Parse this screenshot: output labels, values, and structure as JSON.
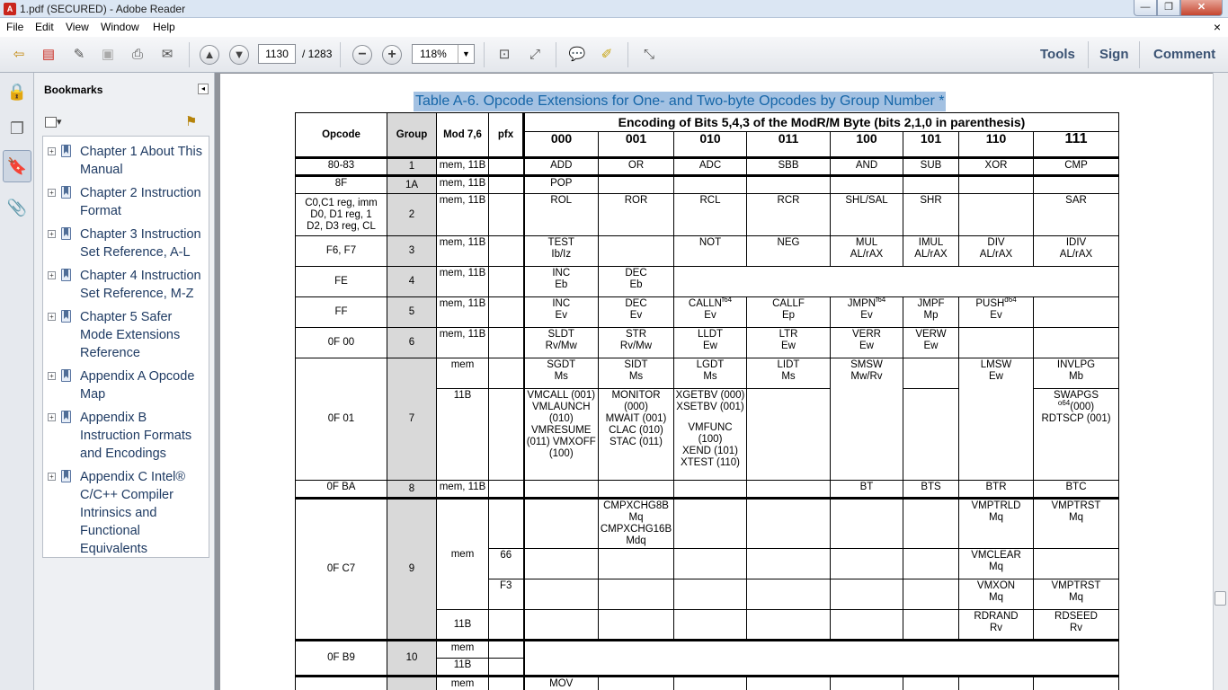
{
  "window": {
    "title": "1.pdf (SECURED) - Adobe Reader",
    "app_icon": "pdf-icon",
    "min_glyph": "—",
    "max_glyph": "❐",
    "close_glyph": "✕"
  },
  "menu": {
    "items": [
      "File",
      "Edit",
      "View",
      "Window",
      "Help"
    ],
    "close_glyph": "×"
  },
  "toolbar": {
    "page_current": "1130",
    "page_total": "/ 1283",
    "zoom": "118%",
    "zoom_arrow": "▼",
    "right_links": {
      "tools": "Tools",
      "sign": "Sign",
      "comment": "Comment"
    }
  },
  "bookmarks": {
    "title": "Bookmarks",
    "collapse_glyph": "◂",
    "options_glyph": "▾",
    "find_glyph": "⚑",
    "expand_glyph": "+",
    "items": [
      "Chapter 1 About This Manual",
      "Chapter 2 Instruction Format",
      "Chapter 3 Instruction Set Reference, A-L",
      "Chapter 4 Instruction Set Reference, M-Z",
      "Chapter 5 Safer Mode Extensions Reference",
      "Appendix A Opcode Map",
      "Appendix B Instruction Formats and Encodings",
      "Appendix C Intel® C/C++ Compiler Intrinsics and Functional Equivalents"
    ]
  },
  "doc": {
    "table_title": "Table A-6.  Opcode Extensions for One- and Two-byte Opcodes by Group Number *",
    "header": {
      "opcode": "Opcode",
      "group": "Group",
      "mod": "Mod 7,6",
      "pfx": "pfx",
      "encoding": "Encoding of Bits 5,4,3 of the ModR/M Byte (bits 2,1,0 in parenthesis)",
      "bits": [
        "000",
        "001",
        "010",
        "011",
        "100",
        "101",
        "110",
        "111"
      ]
    },
    "rows": {
      "r1": {
        "op": "80-83",
        "grp": "1",
        "mod": "mem, 11B",
        "c": [
          "ADD",
          "OR",
          "ADC",
          "SBB",
          "AND",
          "SUB",
          "XOR",
          "CMP"
        ]
      },
      "r1a": {
        "op": "8F",
        "grp": "1A",
        "mod": "mem, 11B",
        "c0": "POP"
      },
      "r2": {
        "op1": "C0,C1 reg, imm",
        "op2": "D0, D1 reg, 1",
        "op3": "D2, D3 reg, CL",
        "grp": "2",
        "mod": "mem, 11B",
        "c": [
          "ROL",
          "ROR",
          "RCL",
          "RCR",
          "SHL/SAL",
          "SHR",
          "",
          "SAR"
        ]
      },
      "r3": {
        "op": "F6, F7",
        "grp": "3",
        "mod": "mem, 11B",
        "test": "TEST",
        "test2": "Ib/Iz",
        "not": "NOT",
        "neg": "NEG",
        "mul": "MUL",
        "mul2": "AL/rAX",
        "imul": "IMUL",
        "imul2": "AL/rAX",
        "div": "DIV",
        "div2": "AL/rAX",
        "idiv": "IDIV",
        "idiv2": "AL/rAX"
      },
      "r4": {
        "op": "FE",
        "grp": "4",
        "mod": "mem, 11B",
        "inc": "INC",
        "inc2": "Eb",
        "dec": "DEC",
        "dec2": "Eb"
      },
      "r5": {
        "op": "FF",
        "grp": "5",
        "mod": "mem, 11B",
        "inc": "INC",
        "inc2": "Ev",
        "dec": "DEC",
        "dec2": "Ev",
        "calln": "CALLN",
        "calln_sup": "f64",
        "calln2": "Ev",
        "callf": "CALLF",
        "callf2": "Ep",
        "jmpn": "JMPN",
        "jmpn_sup": "f64",
        "jmpn2": "Ev",
        "jmpf": "JMPF",
        "jmpf2": "Mp",
        "push": "PUSH",
        "push_sup": "d64",
        "push2": "Ev"
      },
      "r6": {
        "op": "0F 00",
        "grp": "6",
        "mod": "mem, 11B",
        "sldt": "SLDT",
        "sldt2": "Rv/Mw",
        "str": "STR",
        "str2": "Rv/Mw",
        "lldt": "LLDT",
        "lldt2": "Ew",
        "ltr": "LTR",
        "ltr2": "Ew",
        "verr": "VERR",
        "verr2": "Ew",
        "verw": "VERW",
        "verw2": "Ew"
      },
      "r7": {
        "op": "0F 01",
        "grp": "7",
        "mod_mem": "mem",
        "mod_11b": "11B",
        "sgdt": "SGDT",
        "sgdt2": "Ms",
        "sidt": "SIDT",
        "sidt2": "Ms",
        "lgdt": "LGDT",
        "lgdt2": "Ms",
        "lidt": "LIDT",
        "lidt2": "Ms",
        "smsw": "SMSW",
        "smsw2": "Mw/Rv",
        "lmsw": "LMSW",
        "lmsw2": "Ew",
        "invlpg": "INVLPG",
        "invlpg2": "Mb",
        "c000": [
          "VMCALL (001)",
          "VMLAUNCH",
          "(010)",
          "VMRESUME",
          "(011) VMXOFF",
          "(100)"
        ],
        "c001": [
          "MONITOR",
          "(000)",
          "MWAIT (001)",
          "CLAC (010)",
          "STAC (011)"
        ],
        "c010": [
          "XGETBV (000)",
          "XSETBV (001)",
          "",
          "VMFUNC",
          "(100)",
          "XEND (101)",
          "XTEST (110)"
        ],
        "c111_a": "SWAPGS",
        "c111_sup": "o64",
        "c111_b": "(000)",
        "c111_c": "RDTSCP (001)"
      },
      "r8": {
        "op": "0F BA",
        "grp": "8",
        "mod": "mem, 11B",
        "c": [
          "BT",
          "BTS",
          "BTR",
          "BTC"
        ]
      },
      "r9": {
        "op": "0F C7",
        "grp": "9",
        "mod_mem": "mem",
        "mod_11b": "11B",
        "pfx66": "66",
        "pfxf3": "F3",
        "cmpx1": "CMPXCHG8B Mq",
        "cmpx2": "CMPXCHG16B",
        "cmpx3": "Mdq",
        "vmptrld": "VMPTRLD",
        "vmptrld2": "Mq",
        "vmptrst": "VMPTRST",
        "vmptrst2": "Mq",
        "vmclear": "VMCLEAR",
        "vmclear2": "Mq",
        "vmxon": "VMXON",
        "vmxon2": "Mq",
        "vmptrst_b": "VMPTRST",
        "vmptrst_b2": "Mq",
        "rdrand": "RDRAND",
        "rdrand2": "Rv",
        "rdseed": "RDSEED",
        "rdseed2": "Rv"
      },
      "r10": {
        "op": "0F B9",
        "grp": "10",
        "mod_mem": "mem",
        "mod_11b": "11B"
      },
      "r11": {
        "mod": "mem",
        "c0": "MOV"
      }
    }
  },
  "icons": [
    "open-icon",
    "create-pdf-icon",
    "edit-icon",
    "save-icon",
    "print-icon",
    "email-icon",
    "page-up-icon",
    "page-down-icon",
    "zoom-out-icon",
    "zoom-in-icon",
    "fit-page-icon",
    "fit-width-icon",
    "comment-icon",
    "highlight-icon",
    "fullscreen-icon",
    "lock-icon",
    "pages-icon",
    "bookmark-icon",
    "attachment-icon"
  ]
}
